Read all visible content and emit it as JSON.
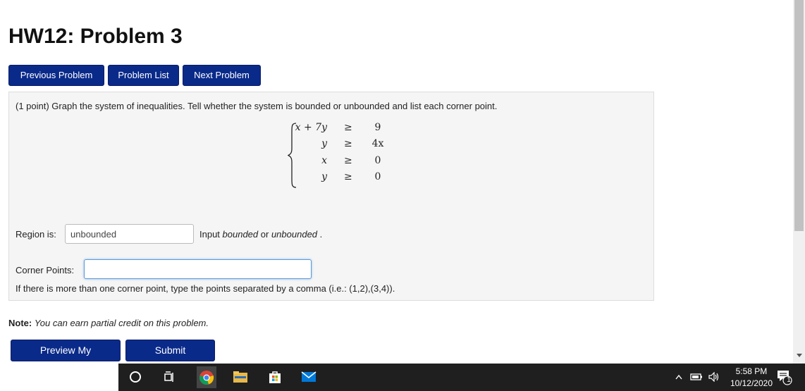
{
  "page": {
    "title": "HW12: Problem 3"
  },
  "nav": {
    "previous": "Previous Problem",
    "list": "Problem List",
    "next": "Next Problem"
  },
  "problem": {
    "statement": "(1 point) Graph the system of inequalities. Tell whether the system is bounded or unbounded and list each corner point.",
    "system": [
      {
        "lhs": "x + 7y",
        "op": "≥",
        "rhs": "9"
      },
      {
        "lhs": "y",
        "op": "≥",
        "rhs": "4x"
      },
      {
        "lhs": "x",
        "op": "≥",
        "rhs": "0"
      },
      {
        "lhs": "y",
        "op": "≥",
        "rhs": "0"
      }
    ],
    "region_label": "Region is:",
    "region_value": "unbounded",
    "region_hint_prefix": "Input ",
    "region_hint_bounded": "bounded",
    "region_hint_or": " or ",
    "region_hint_unbounded": "unbounded",
    "region_hint_suffix": " .",
    "corner_label": "Corner Points:",
    "corner_value": "",
    "corner_help": "If there is more than one corner point, type the points separated by a comma (i.e.: (1,2),(3,4))."
  },
  "note": {
    "label": "Note:",
    "text": "You can earn partial credit on this problem."
  },
  "actions": {
    "preview": "Preview My Answers",
    "submit": "Submit Answers"
  },
  "taskbar": {
    "time": "5:58 PM",
    "date": "10/12/2020",
    "notification_count": "1",
    "icons": [
      "cortana-icon",
      "task-view-icon",
      "chrome-icon",
      "file-explorer-icon",
      "store-icon",
      "mail-icon"
    ]
  }
}
